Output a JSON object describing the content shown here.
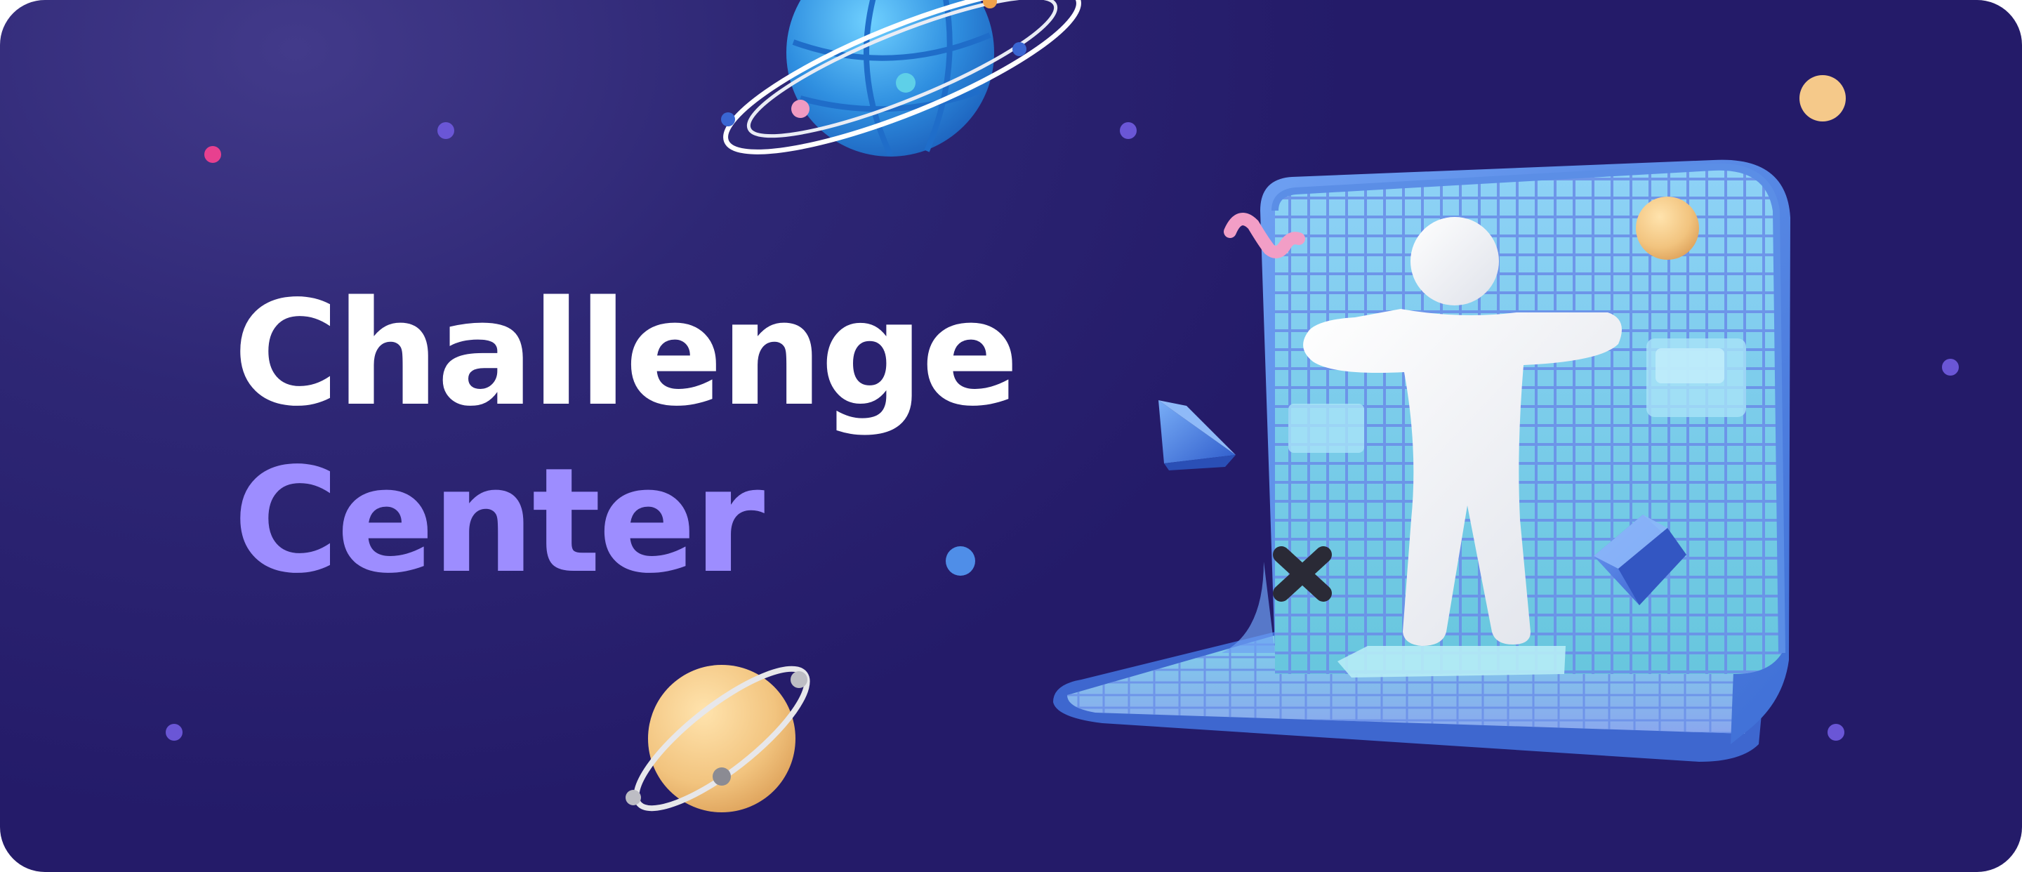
{
  "banner": {
    "title_line_1": "Challenge",
    "title_line_2": "Center"
  },
  "colors": {
    "background": "#2a2270",
    "title_primary": "#ffffff",
    "title_accent": "#9d8dff",
    "grid_blue": "#5b8ee6",
    "grid_cyan": "#7fd3f0",
    "planet_gold": "#f2c47f",
    "globe_blue": "#2f8fe0",
    "figure_white": "#f3f4f8"
  },
  "decorations": [
    "globe-planet-icon",
    "ringed-planet-icon",
    "wireframe-laptop-screen",
    "human-figure",
    "pyramid-shape",
    "cube-shape",
    "cross-shape",
    "squiggle-shape",
    "sphere-shape",
    "star-dots"
  ]
}
